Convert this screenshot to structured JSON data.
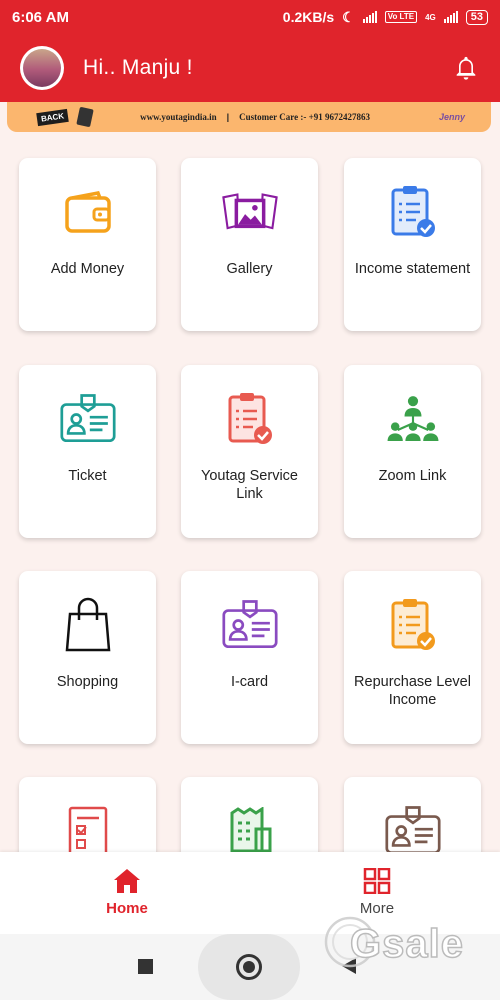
{
  "status": {
    "time": "6:06 AM",
    "net_speed": "0.2KB/s",
    "volte": "Vo LTE",
    "network": "4G",
    "battery": "53"
  },
  "header": {
    "greeting": "Hi.. Manju !"
  },
  "banner": {
    "back": "BACK",
    "website": "www.youtagindia.in",
    "separator": "|",
    "customer_care": "Customer Care :- +91 9672427863",
    "tagline": "Jenny"
  },
  "menu": [
    {
      "label": "Add Money",
      "icon": "wallet-icon"
    },
    {
      "label": "Gallery",
      "icon": "gallery-icon"
    },
    {
      "label": "Income statement",
      "icon": "clipboard-check-icon"
    },
    {
      "label": "Ticket",
      "icon": "id-badge-icon"
    },
    {
      "label": "Youtag Service Link",
      "icon": "clipboard-check-icon"
    },
    {
      "label": "Zoom Link",
      "icon": "network-people-icon"
    },
    {
      "label": "Shopping",
      "icon": "shopping-bag-icon"
    },
    {
      "label": "I-card",
      "icon": "id-badge-icon"
    },
    {
      "label": "Repurchase Level Income",
      "icon": "clipboard-check-icon"
    },
    {
      "label": "",
      "icon": "checklist-icon"
    },
    {
      "label": "",
      "icon": "receipt-icon"
    },
    {
      "label": "",
      "icon": "id-badge-icon"
    }
  ],
  "bottom_nav": {
    "home": "Home",
    "more": "More"
  },
  "watermark": "Gsale",
  "colors": {
    "primary": "#e0242c",
    "background": "#fcf1ee"
  }
}
